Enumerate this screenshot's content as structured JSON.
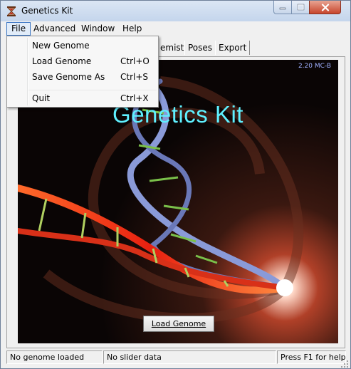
{
  "window": {
    "title": "Genetics Kit"
  },
  "menubar": [
    "File",
    "Advanced",
    "Window",
    "Help"
  ],
  "tabs": [
    "emistry",
    "Poses",
    "Export"
  ],
  "file_menu": [
    {
      "label": "New Genome",
      "shortcut": ""
    },
    {
      "label": "Load Genome",
      "shortcut": "Ctrl+O"
    },
    {
      "label": "Save Genome As",
      "shortcut": "Ctrl+S"
    },
    {
      "label": "Quit",
      "shortcut": "Ctrl+X"
    }
  ],
  "splash": {
    "title": "Genetics Kit",
    "version": "2.20 MC-B"
  },
  "load_button": "Load Genome",
  "status": {
    "genome": "No genome loaded",
    "slider": "No slider data",
    "help": "Press F1 for help"
  },
  "colors": {
    "title_cyan": "#5ff0ff",
    "menu_highlight": "#e1ecf9",
    "close_red": "#c7452c"
  },
  "icons": {
    "app": "hourglass-dna-icon",
    "minimize": "minimize-icon",
    "maximize": "maximize-icon",
    "close": "close-icon"
  }
}
